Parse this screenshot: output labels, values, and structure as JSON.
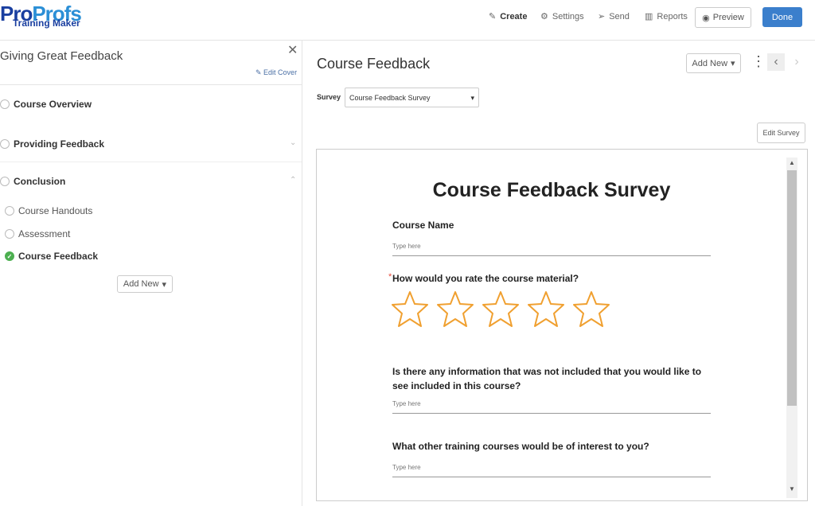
{
  "header": {
    "logo_top": "ProProfs",
    "logo_bottom": "Training Maker",
    "nav": [
      {
        "label": "Create",
        "icon": "pencil-icon"
      },
      {
        "label": "Settings",
        "icon": "gear-icon"
      },
      {
        "label": "Send",
        "icon": "send-icon"
      },
      {
        "label": "Reports",
        "icon": "bar-chart-icon"
      }
    ],
    "preview": "Preview",
    "done": "Done",
    "accent": "#3b7fcc"
  },
  "sidebar": {
    "title": "Giving Great Feedback",
    "edit_cover": "Edit Cover",
    "sections": [
      {
        "label": "Course Overview"
      },
      {
        "label": "Providing Feedback"
      },
      {
        "label": "Conclusion"
      }
    ],
    "items": [
      {
        "label": "Course Handouts",
        "done": false
      },
      {
        "label": "Assessment",
        "done": false
      },
      {
        "label": "Course Feedback",
        "done": true
      }
    ],
    "add_new": "Add New"
  },
  "main": {
    "title": "Course Feedback",
    "add_new": "Add New",
    "survey_label": "Survey",
    "survey_value": "Course Feedback Survey",
    "edit_survey": "Edit Survey"
  },
  "survey": {
    "title": "Course Feedback Survey",
    "q1": "Course Name",
    "q1_placeholder": "Type here",
    "q2": "How would you rate the course material?",
    "q2_required": "*",
    "stars": 5,
    "q3": "Is there any information that was not included that you would like to see included in this course?",
    "q3_placeholder": "Type here",
    "q4": "What other training courses would be of interest to you?",
    "q4_placeholder": "Type here"
  }
}
